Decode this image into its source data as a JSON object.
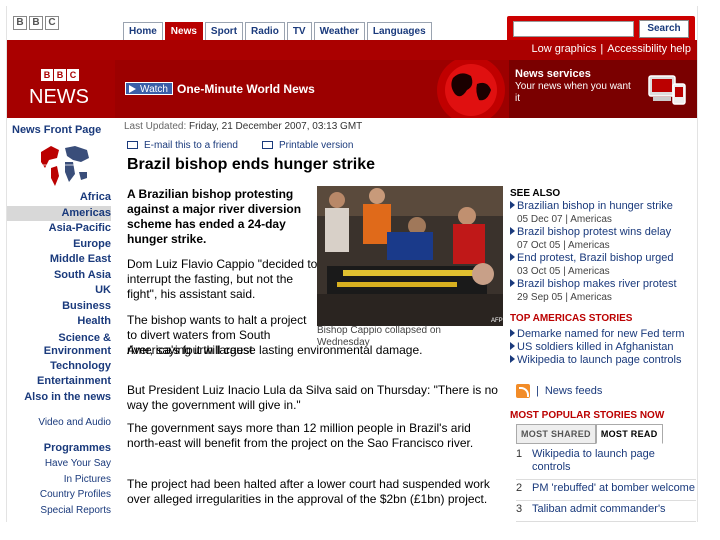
{
  "top": {
    "bbc_letters": [
      "B",
      "B",
      "C"
    ],
    "tabs": [
      "Home",
      "News",
      "Sport",
      "Radio",
      "TV",
      "Weather",
      "Languages"
    ],
    "active_tab": "News",
    "search_button": "Search",
    "links": [
      "Low graphics",
      "Accessibility help"
    ],
    "link_sep": "|"
  },
  "masthead": {
    "logo_letters": [
      "B",
      "B",
      "C"
    ],
    "logo_word": "NEWS",
    "watch_label": "Watch",
    "bulletin_title": "One-Minute World News",
    "services_title": "News services",
    "services_text": "Your news when you want it"
  },
  "nav": {
    "front_page": "News Front Page",
    "items": [
      {
        "label": "Africa",
        "style": "bold"
      },
      {
        "label": "Americas",
        "style": "bold",
        "active": true
      },
      {
        "label": "Asia-Pacific",
        "style": "bold"
      },
      {
        "label": "Europe",
        "style": "bold"
      },
      {
        "label": "Middle East",
        "style": "bold"
      },
      {
        "label": "South Asia",
        "style": "bold"
      },
      {
        "label": "UK",
        "style": "bold"
      },
      {
        "label": "Business",
        "style": "bold"
      },
      {
        "label": "Health",
        "style": "bold"
      },
      {
        "label": "Science & Environment",
        "style": "bold"
      },
      {
        "label": "Technology",
        "style": "bold"
      },
      {
        "label": "Entertainment",
        "style": "bold"
      },
      {
        "label": "Also in the news",
        "style": "bold"
      },
      {
        "label": "Video and Audio",
        "style": "small"
      },
      {
        "label": "Programmes",
        "style": "bold"
      },
      {
        "label": "Have Your Say",
        "style": "small"
      },
      {
        "label": "In Pictures",
        "style": "small"
      },
      {
        "label": "Country Profiles",
        "style": "small"
      },
      {
        "label": "Special Reports",
        "style": "small"
      }
    ]
  },
  "article": {
    "updated_label": "Last Updated:",
    "updated_value": "Friday, 21 December 2007, 03:13 GMT",
    "email_link": "E-mail this to a friend",
    "print_link": "Printable version",
    "headline": "Brazil bishop ends hunger strike",
    "intro": "A Brazilian bishop protesting against a major river diversion scheme has ended a 24-day hunger strike.",
    "caption": "Bishop Cappio collapsed on Wednesday",
    "photo_credit": "AFP",
    "p1": "Dom Luiz Flavio Cappio \"decided to interrupt the fasting, but not the fight\", his assistant said.",
    "p2": "The bishop wants to halt a project to divert waters from South America's fourth largest",
    "p2b": "river, saying it will cause lasting environmental damage.",
    "p3": "But President Luiz Inacio Lula da Silva said on Thursday: \"There is no way the government will give in.\"",
    "p4": "The government says more than 12 million people in Brazil's arid north-east will benefit from the project on the Sao Francisco river.",
    "p5": "The project had been halted after a lower court had suspended work over alleged irregularities in the approval of the $2bn (£1bn) project."
  },
  "sidebar": {
    "see_also_title": "SEE ALSO",
    "see_also": [
      {
        "title": "Brazilian bishop in hunger strike",
        "date": "05 Dec 07",
        "section": "Americas"
      },
      {
        "title": "Brazil bishop protest wins delay",
        "date": "07 Oct 05",
        "section": "Americas"
      },
      {
        "title": "End protest, Brazil bishop urged",
        "date": "03 Oct 05",
        "section": "Americas"
      },
      {
        "title": "Brazil bishop makes river protest",
        "date": "29 Sep 05",
        "section": "Americas"
      }
    ],
    "date_sep": "|",
    "top_stories_title": "TOP AMERICAS STORIES",
    "top_stories": [
      "Demarke named for new Fed term",
      "US soldiers killed in Afghanistan",
      "Wikipedia to launch page controls"
    ],
    "feeds_label": "News feeds",
    "popular_title": "MOST POPULAR STORIES NOW",
    "popular_tabs": [
      "MOST SHARED",
      "MOST READ"
    ],
    "popular_active": "MOST READ",
    "popular": [
      {
        "num": "1",
        "title": "Wikipedia to launch page controls"
      },
      {
        "num": "2",
        "title": "PM 'rebuffed' at bomber welcome"
      },
      {
        "num": "3",
        "title": "Taliban admit commander's"
      }
    ]
  }
}
